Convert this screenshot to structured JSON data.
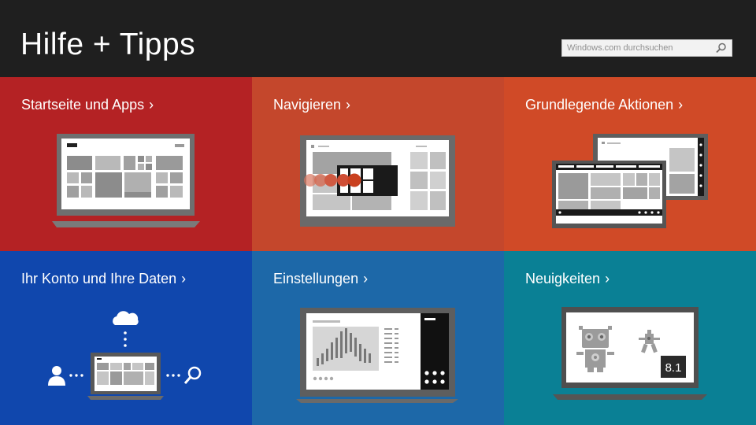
{
  "header": {
    "title": "Hilfe + Tipps",
    "search_placeholder": "Windows.com durchsuchen",
    "search_icon": "search-icon"
  },
  "tiles": [
    {
      "label": "Startseite und Apps",
      "color": "#b42224",
      "chevron": "›"
    },
    {
      "label": "Navigieren",
      "color": "#c4472c",
      "chevron": "›"
    },
    {
      "label": "Grundlegende Aktionen",
      "color": "#d04a27",
      "chevron": "›"
    },
    {
      "label": "Ihr Konto und Ihre Daten",
      "color": "#1047ad",
      "chevron": "›"
    },
    {
      "label": "Einstellungen",
      "color": "#1d68a8",
      "chevron": "›"
    },
    {
      "label": "Neuigkeiten",
      "color": "#0a8095",
      "chevron": "›"
    }
  ],
  "news_badge": "8.1",
  "colors": {
    "header_bg": "#1f1f1f",
    "text": "#ffffff"
  }
}
